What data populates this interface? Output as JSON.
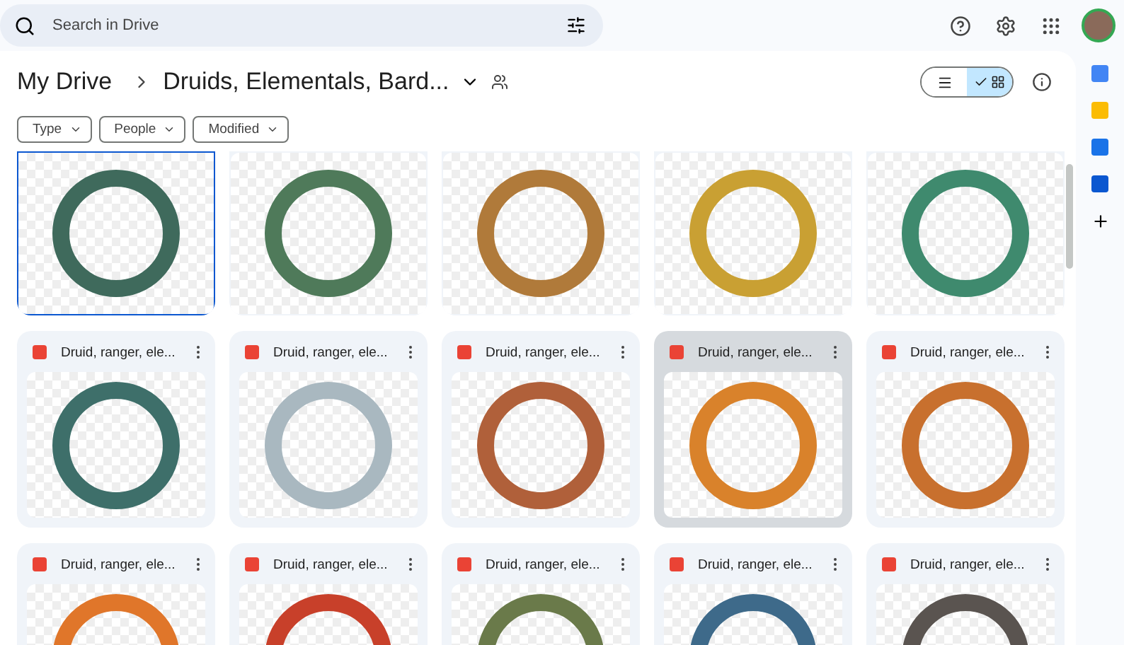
{
  "search": {
    "placeholder": "Search in Drive"
  },
  "breadcrumb": [
    {
      "label": "My Drive"
    },
    {
      "label": "Druids, Elementals, Bard..."
    }
  ],
  "view_toggle": [
    {
      "kind": "list",
      "selected": false
    },
    {
      "kind": "grid",
      "selected": true
    }
  ],
  "filters": [
    {
      "label": "Type"
    },
    {
      "label": "People"
    },
    {
      "label": "Modified"
    }
  ],
  "rows": [
    {
      "title_visible": false,
      "files": [
        {
          "selected": true,
          "hovered": false,
          "color": "#3f6a5c"
        },
        {
          "selected": false,
          "hovered": false,
          "color": "#4f7a5a"
        },
        {
          "selected": false,
          "hovered": false,
          "color": "#b07a3a"
        },
        {
          "selected": false,
          "hovered": false,
          "color": "#c9a033"
        },
        {
          "selected": false,
          "hovered": false,
          "color": "#3f8a6e"
        }
      ]
    },
    {
      "title_visible": true,
      "files": [
        {
          "name": "Druid, ranger, ele...",
          "selected": false,
          "hovered": false,
          "color": "#3e6f6a"
        },
        {
          "name": "Druid, ranger, ele...",
          "selected": false,
          "hovered": false,
          "color": "#a9b8c0"
        },
        {
          "name": "Druid, ranger, ele...",
          "selected": false,
          "hovered": false,
          "color": "#b0603a"
        },
        {
          "name": "Druid, ranger, ele...",
          "selected": false,
          "hovered": true,
          "color": "#d9822b"
        },
        {
          "name": "Druid, ranger, ele...",
          "selected": false,
          "hovered": false,
          "color": "#c8702e"
        }
      ]
    },
    {
      "title_visible": true,
      "files": [
        {
          "name": "Druid, ranger, ele...",
          "selected": false,
          "hovered": false,
          "color": "#e0762a"
        },
        {
          "name": "Druid, ranger, ele...",
          "selected": false,
          "hovered": false,
          "color": "#c8402a"
        },
        {
          "name": "Druid, ranger, ele...",
          "selected": false,
          "hovered": false,
          "color": "#6a7a4a"
        },
        {
          "name": "Druid, ranger, ele...",
          "selected": false,
          "hovered": false,
          "color": "#3e6a8a"
        },
        {
          "name": "Druid, ranger, ele...",
          "selected": false,
          "hovered": false,
          "color": "#5a5450"
        }
      ]
    }
  ]
}
